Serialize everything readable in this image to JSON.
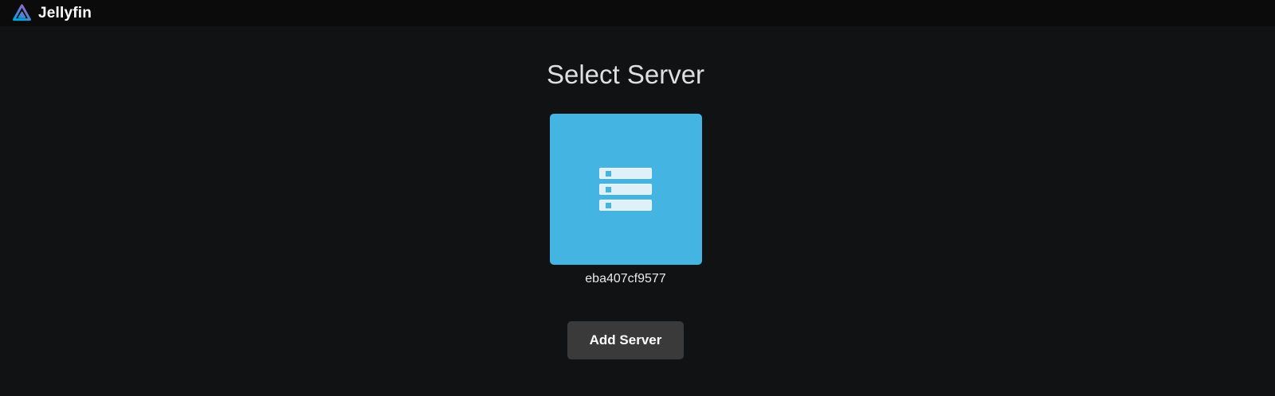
{
  "header": {
    "app_name": "Jellyfin",
    "logo_icon": "jellyfin-triangle-logo"
  },
  "page": {
    "title": "Select Server",
    "servers": [
      {
        "name": "eba407cf9577",
        "icon": "storage-icon",
        "tile_color": "#44b5e2"
      }
    ],
    "add_server_label": "Add Server"
  },
  "colors": {
    "header_bg": "#0b0b0c",
    "body_bg": "#111214",
    "server_tile": "#44b5e2",
    "tile_icon_fill": "#dff0f9",
    "button_bg": "#3a3a3a",
    "button_text": "#ffffff",
    "heading_text": "#dfdfdf",
    "server_name_text": "#eaeaea",
    "logo_gradient_start": "#aa5cc3",
    "logo_gradient_end": "#00a4dc"
  }
}
